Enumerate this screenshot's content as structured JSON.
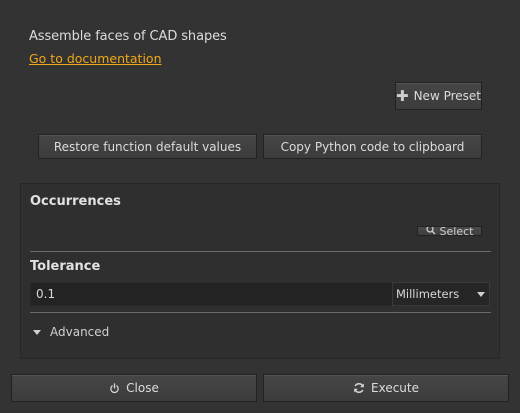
{
  "header": {
    "description": "Assemble faces of CAD shapes",
    "doc_link": "Go to documentation"
  },
  "presets": {
    "new_preset_label": "New Preset",
    "new_preset_icon": "plus-icon"
  },
  "actions": {
    "restore_label": "Restore function default values",
    "copy_label": "Copy Python code to clipboard"
  },
  "occurrences": {
    "title": "Occurrences",
    "select_label": "Select",
    "select_icon": "search-icon"
  },
  "tolerance": {
    "title": "Tolerance",
    "value": "0.1",
    "unit": "Millimeters"
  },
  "advanced": {
    "label": "Advanced"
  },
  "footer": {
    "close_label": "Close",
    "close_icon": "power-icon",
    "execute_label": "Execute",
    "execute_icon": "refresh-icon"
  },
  "colors": {
    "background": "#333333",
    "link": "#f0a81a"
  }
}
